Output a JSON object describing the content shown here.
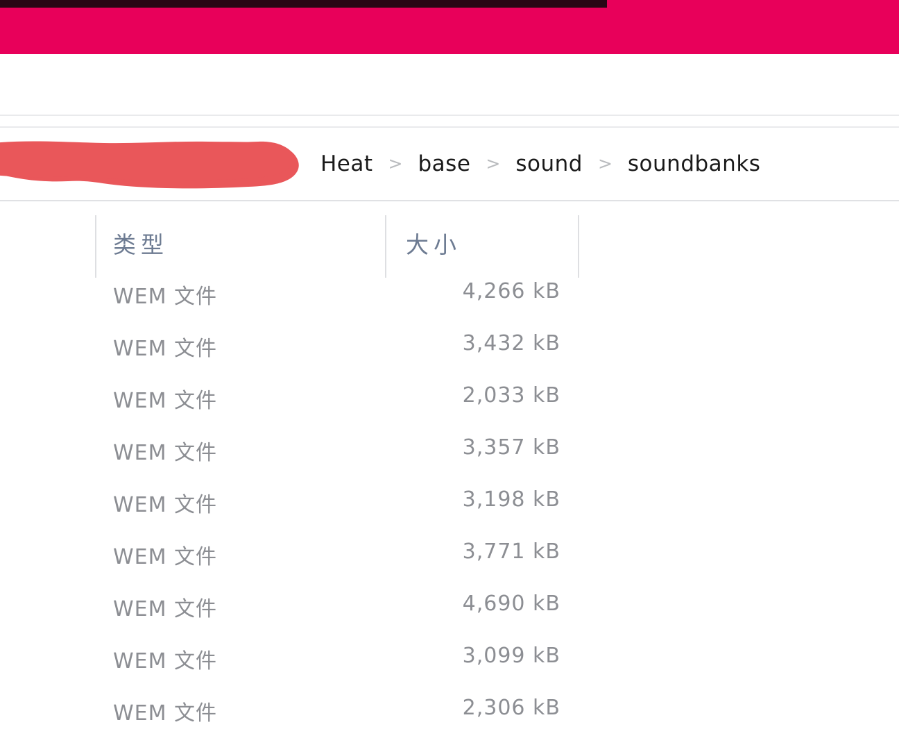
{
  "banner": {
    "color": "#e8005a",
    "strip_color": "#18060f"
  },
  "breadcrumb": {
    "redaction_color": "#e9575a",
    "separator": ">",
    "items": [
      {
        "label": "Heat"
      },
      {
        "label": "base"
      },
      {
        "label": "sound"
      },
      {
        "label": "soundbanks"
      }
    ]
  },
  "table": {
    "columns": [
      {
        "key": "type",
        "header": "类型"
      },
      {
        "key": "size",
        "header": "大小"
      }
    ],
    "rows": [
      {
        "type": "WEM 文件",
        "size": "4,266 kB"
      },
      {
        "type": "WEM 文件",
        "size": "3,432 kB"
      },
      {
        "type": "WEM 文件",
        "size": "2,033 kB"
      },
      {
        "type": "WEM 文件",
        "size": "3,357 kB"
      },
      {
        "type": "WEM 文件",
        "size": "3,198 kB"
      },
      {
        "type": "WEM 文件",
        "size": "3,771 kB"
      },
      {
        "type": "WEM 文件",
        "size": "4,690 kB"
      },
      {
        "type": "WEM 文件",
        "size": "3,099 kB"
      },
      {
        "type": "WEM 文件",
        "size": "2,306 kB"
      }
    ]
  }
}
